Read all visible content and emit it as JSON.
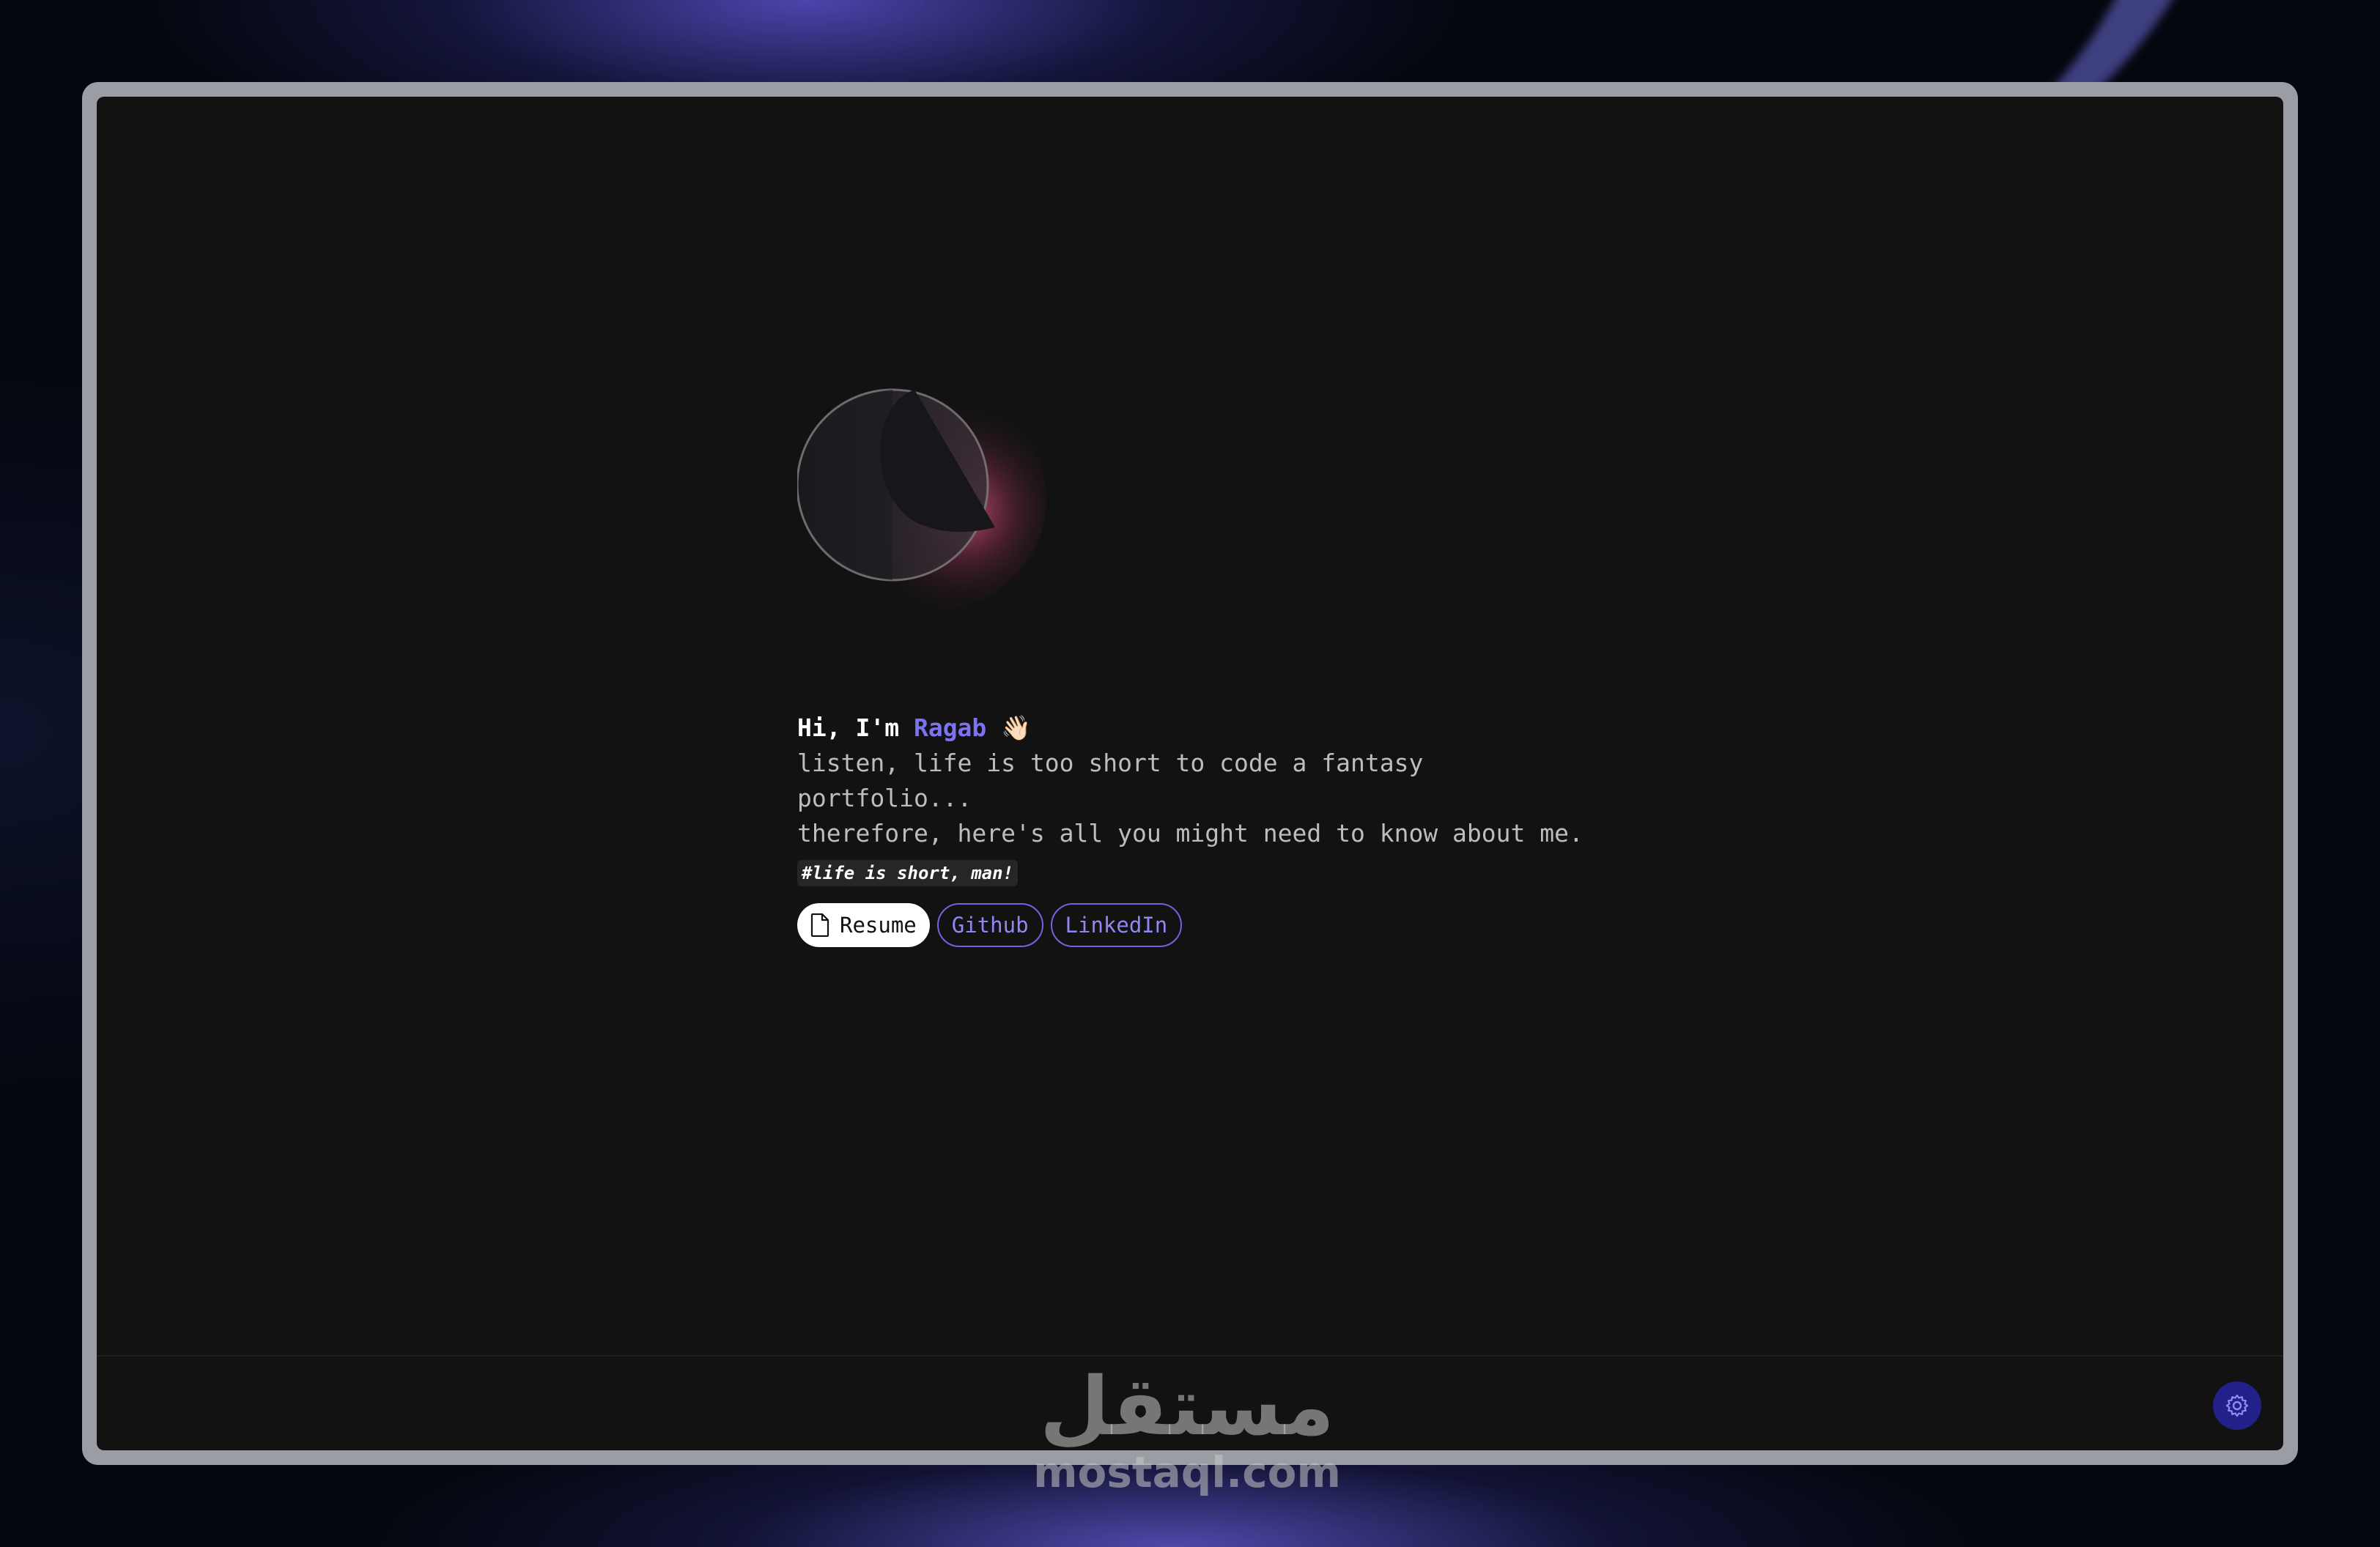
{
  "hero": {
    "greeting_prefix": "Hi, I'm ",
    "name": "Ragab",
    "wave": "👋🏻",
    "description_line1": "listen, life is too short to code a fantasy",
    "description_line2": "portfolio...",
    "description_line3": "therefore, here's all you might need to know about me.",
    "tag": "#life is short, man!"
  },
  "links": {
    "resume_label": "Resume",
    "github_label": "Github",
    "linkedin_label": "LinkedIn"
  },
  "watermark": {
    "arabic": "مستقل",
    "latin": "mostaql.com"
  },
  "colors": {
    "accent": "#7b73f0",
    "screen_bg": "#121212",
    "frame": "#9a9ea4"
  },
  "icons": {
    "resume": "document-icon",
    "settings": "gear-icon"
  }
}
